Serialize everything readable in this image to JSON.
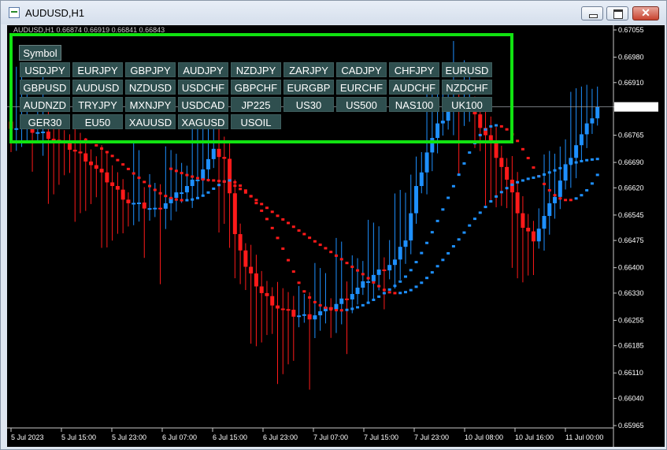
{
  "window": {
    "title": "AUDUSD,H1",
    "minimize_icon": "minimize-icon",
    "maximize_icon": "maximize-icon",
    "close_icon": "close-icon",
    "close_glyph": "✕"
  },
  "chart": {
    "info": "AUDUSD,H1  0.66874 0.66919 0.66841 0.66843",
    "current_price": "0.66843",
    "price_axis": [
      "0.67055",
      "0.66980",
      "0.66910",
      "0.66843",
      "0.66765",
      "0.66690",
      "0.66620",
      "0.66545",
      "0.66475",
      "0.66400",
      "0.66330",
      "0.66255",
      "0.66185",
      "0.66110",
      "0.66040",
      "0.65965"
    ],
    "time_axis": [
      "5 Jul 2023",
      "5 Jul 15:00",
      "5 Jul 23:00",
      "6 Jul 07:00",
      "6 Jul 15:00",
      "6 Jul 23:00",
      "7 Jul 07:00",
      "7 Jul 15:00",
      "7 Jul 23:00",
      "10 Jul 08:00",
      "10 Jul 16:00",
      "11 Jul 00:00"
    ],
    "colors": {
      "bull": "#1e90ff",
      "bear": "#ff1a1a",
      "background": "#000000",
      "panel_border": "#11e311",
      "button_bg": "#2f4f4f"
    }
  },
  "symbol_panel": {
    "tab_label": "Symbol",
    "rows": [
      [
        "USDJPY",
        "EURJPY",
        "GBPJPY",
        "AUDJPY",
        "NZDJPY",
        "ZARJPY",
        "CADJPY",
        "CHFJPY",
        "EURUSD"
      ],
      [
        "GBPUSD",
        "AUDUSD",
        "NZDUSD",
        "USDCHF",
        "GBPCHF",
        "EURGBP",
        "EURCHF",
        "AUDCHF",
        "NZDCHF"
      ],
      [
        "AUDNZD",
        "TRYJPY",
        "MXNJPY",
        "USDCAD",
        "JP225",
        "US30",
        "US500",
        "NAS100",
        "UK100"
      ],
      [
        "GER30",
        "EU50",
        "XAUUSD",
        "XAGUSD",
        "USOIL"
      ]
    ]
  }
}
